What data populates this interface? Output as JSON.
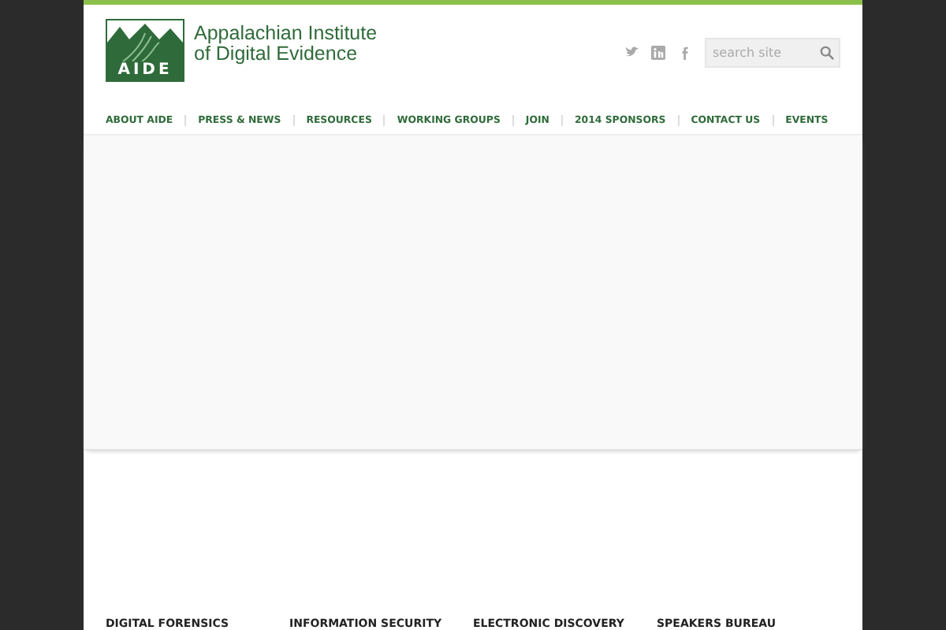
{
  "logo": {
    "mark": "AIDE",
    "name_line_1": "Appalachian Institute",
    "name_line_2": "of Digital Evidence"
  },
  "search": {
    "placeholder": "search site"
  },
  "nav": [
    {
      "label": "ABOUT AIDE"
    },
    {
      "label": "PRESS & NEWS"
    },
    {
      "label": "RESOURCES"
    },
    {
      "label": "WORKING GROUPS"
    },
    {
      "label": "JOIN"
    },
    {
      "label": "2014 SPONSORS"
    },
    {
      "label": "CONTACT US"
    },
    {
      "label": "EVENTS"
    }
  ],
  "sections": [
    "DIGITAL FORENSICS",
    "INFORMATION SECURITY",
    "ELECTRONIC DISCOVERY",
    "SPEAKERS BUREAU"
  ]
}
